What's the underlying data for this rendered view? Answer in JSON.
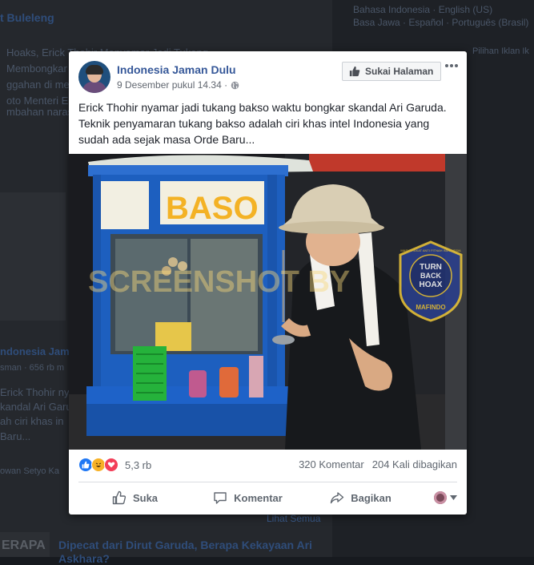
{
  "background": {
    "left_header": "t Buleleng",
    "left_lines": [
      "Hoaks, Erick Thohir Menyamar Jadi Tukang",
      "Membongkar",
      "ggahan di me",
      "oto Menteri E",
      "mbahan narasi"
    ],
    "left_page_name": "ndonesia Jama",
    "left_page_meta": "sman · 656 rb m",
    "left_post_lines": [
      "Erick Thohir ny",
      "kandal Ari Garu",
      "ah ciri khas in",
      "Baru..."
    ],
    "left_caption": "owan Setyo Ka",
    "see_all": "Lihat Semua",
    "bottom_badge": "ERAPA",
    "bottom_title": "Dipecat dari Dirut Garuda, Berapa Kekayaan Ari",
    "bottom_title_2": "Askhara?",
    "languages_line1": "Bahasa Indonesia · English (US)",
    "languages_line2": "Basa Jawa · Español · Português (Brasil)",
    "right_note": "Pilihan Iklan  Ik"
  },
  "post": {
    "page_name": "Indonesia Jaman Dulu",
    "timestamp": "9 Desember pukul 14.34 ·",
    "like_page_label": "Sukai Halaman",
    "text": "Erick Thohir nyamar jadi tukang bakso waktu bongkar skandal Ari Garuda. Teknik penyamaran tukang bakso adalah ciri khas intel Indonesia yang sudah ada sejak masa Orde Baru...",
    "photo": {
      "cart_sign": "BASO",
      "watermark": "SCREENSHOT BY",
      "badge_line1": "TURN",
      "badge_line2": "BACK",
      "badge_line3": "HOAX",
      "badge_org": "MAFINDO",
      "badge_ring": "MASYARAKAT ANTI FITNAH INDONESIA"
    },
    "reaction_count": "5,3 rb",
    "comments": "320 Komentar",
    "shares": "204 Kali dibagikan",
    "actions": {
      "like": "Suka",
      "comment": "Komentar",
      "share": "Bagikan"
    }
  },
  "colors": {
    "link_blue": "#365899",
    "like_blue": "#2078f4",
    "haha_yellow": "#f7b125",
    "love_red": "#f33e58"
  }
}
